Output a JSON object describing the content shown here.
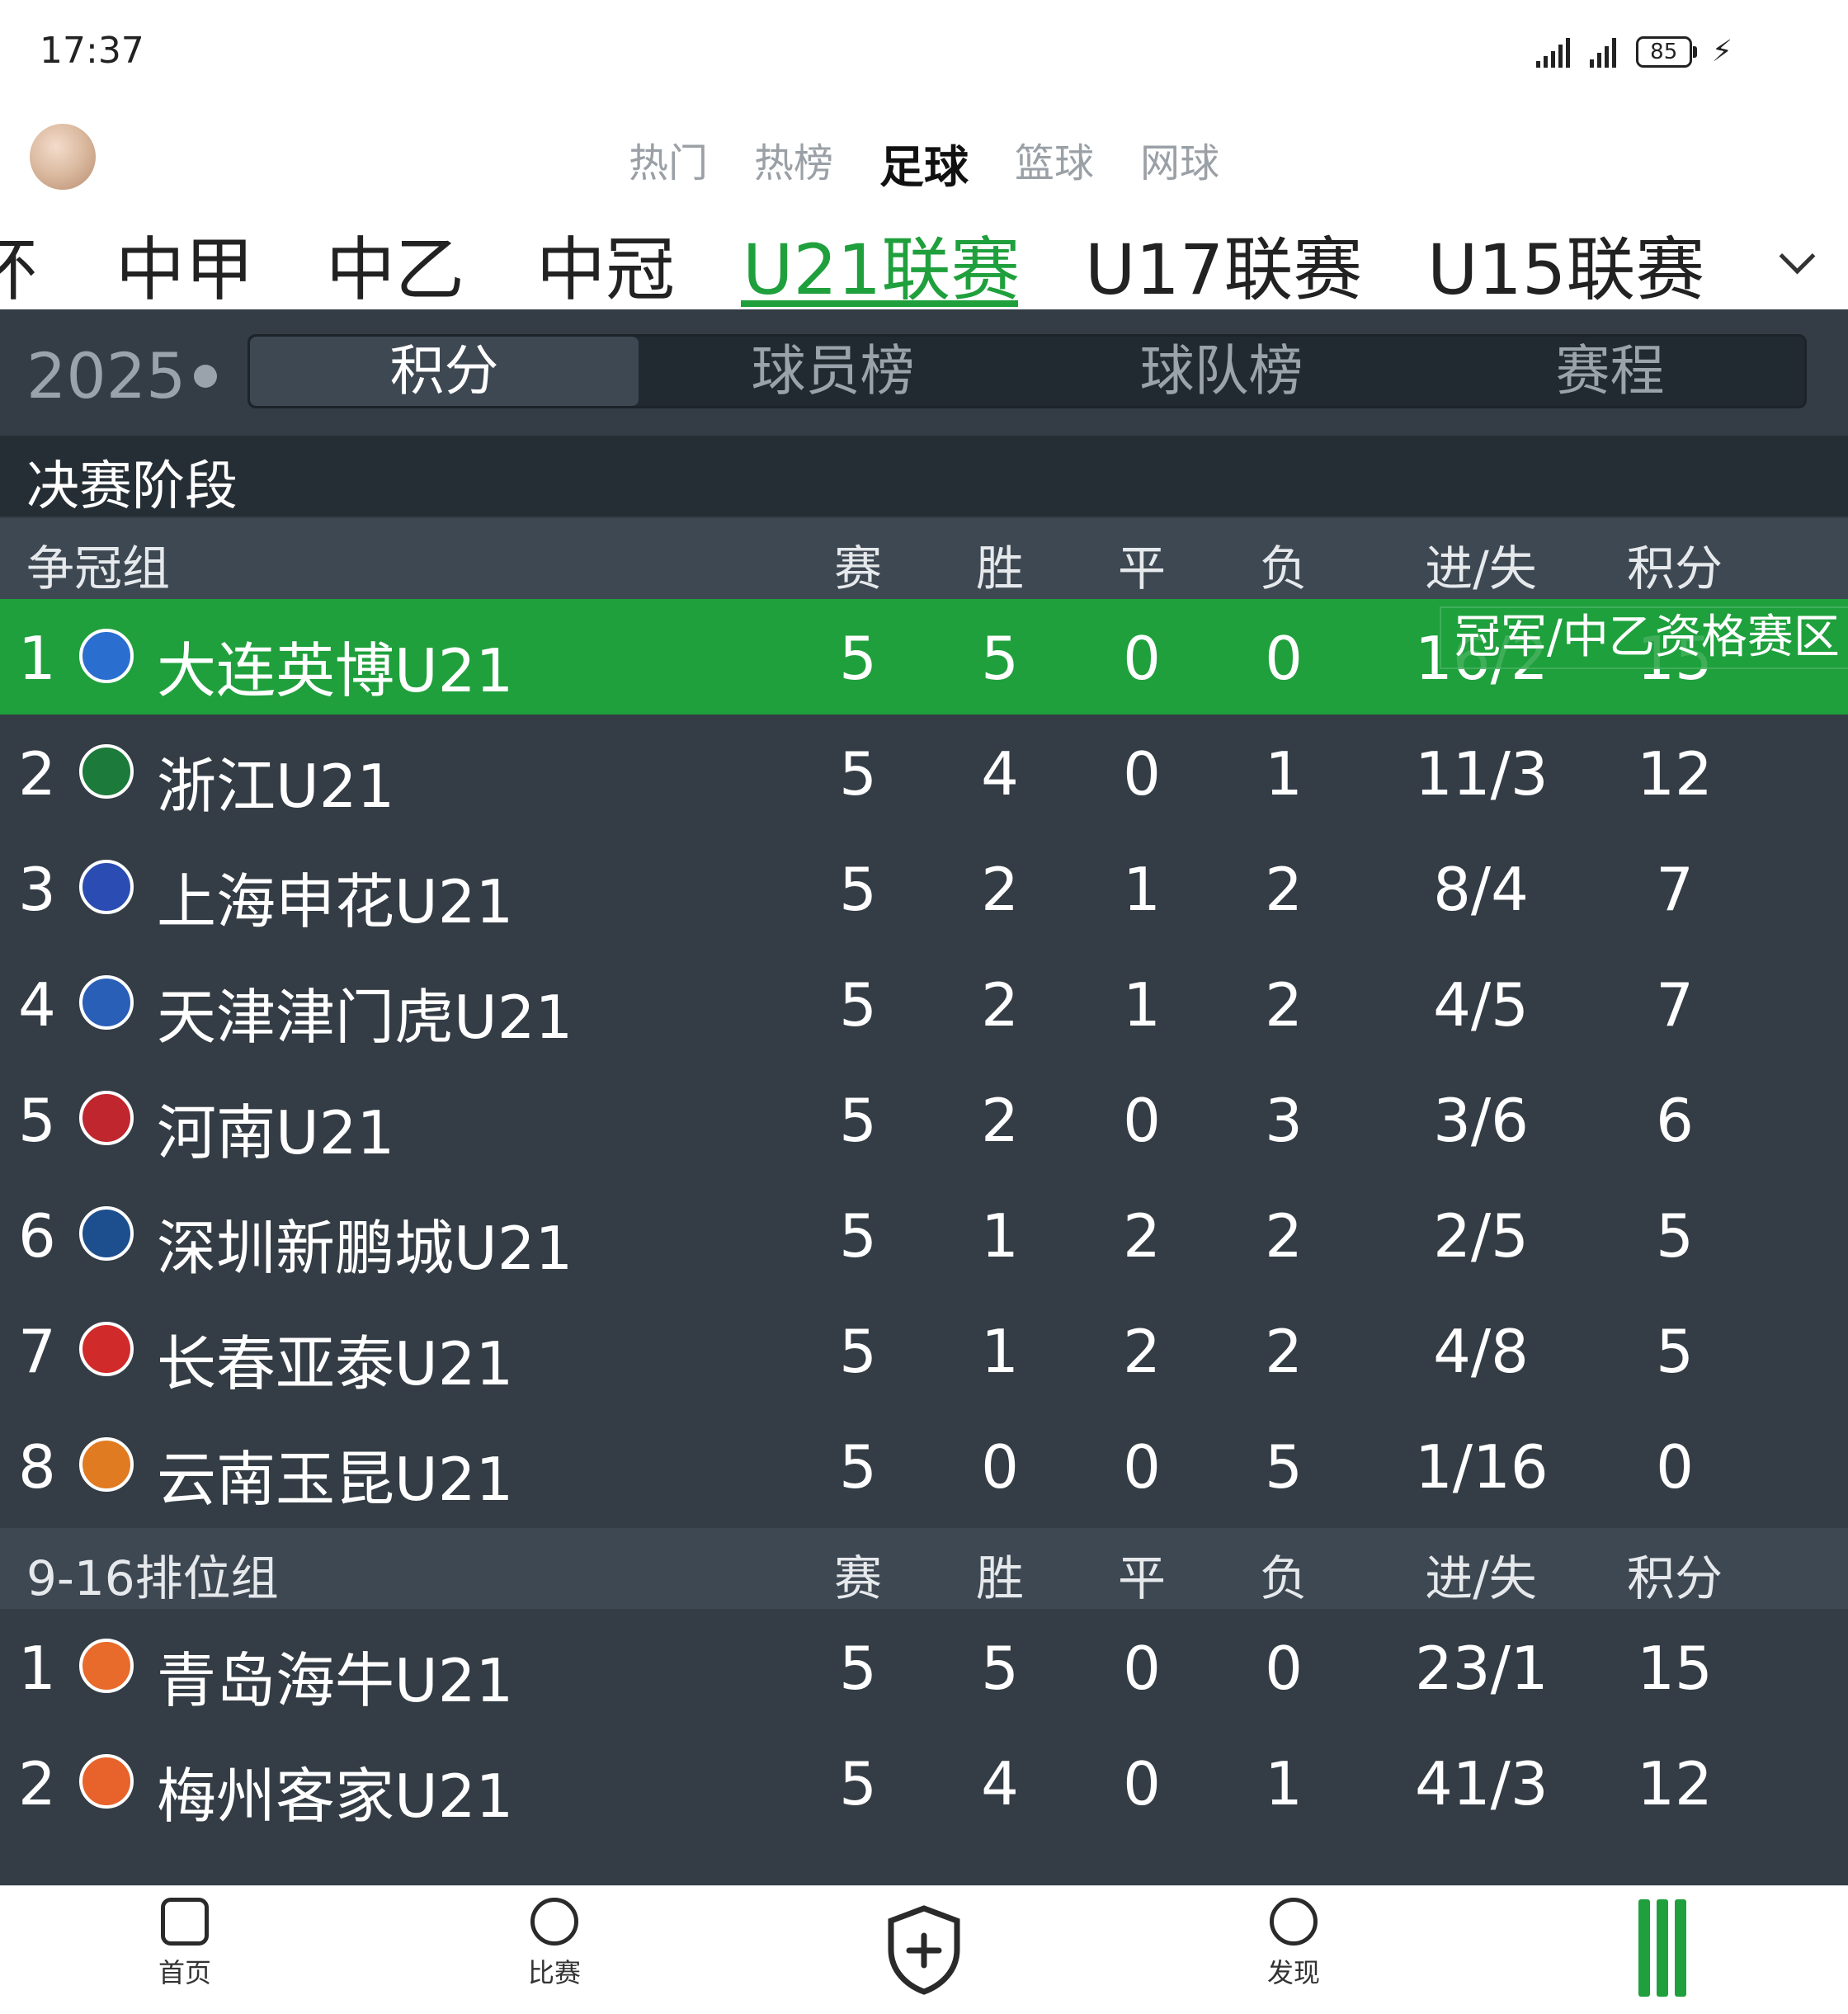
{
  "status_bar": {
    "time": "17:37",
    "battery": "85"
  },
  "top_tabs": [
    "热门",
    "热榜",
    "足球",
    "篮球",
    "网球"
  ],
  "top_tab_active": "足球",
  "league_tabs": [
    "杯",
    "中甲",
    "中乙",
    "中冠",
    "U21联赛",
    "U17联赛",
    "U15联赛"
  ],
  "league_tab_active": "U21联赛",
  "season": "2025",
  "segment_tabs": [
    "积分",
    "球员榜",
    "球队榜",
    "赛程"
  ],
  "segment_active": "积分",
  "stage_label": "决赛阶段",
  "columns": [
    "赛",
    "胜",
    "平",
    "负",
    "进/失",
    "积分"
  ],
  "zone_badge": "冠军/中乙资格赛区",
  "groups": [
    {
      "name": "争冠组",
      "rows": [
        {
          "rank": "1",
          "team": "大连英博U21",
          "p": "5",
          "w": "5",
          "d": "0",
          "l": "0",
          "gf_ga": "16/2",
          "pts": "15",
          "logo_color": "#2a6fd0",
          "highlight": true
        },
        {
          "rank": "2",
          "team": "浙江U21",
          "p": "5",
          "w": "4",
          "d": "0",
          "l": "1",
          "gf_ga": "11/3",
          "pts": "12",
          "logo_color": "#1c7a3a"
        },
        {
          "rank": "3",
          "team": "上海申花U21",
          "p": "5",
          "w": "2",
          "d": "1",
          "l": "2",
          "gf_ga": "8/4",
          "pts": "7",
          "logo_color": "#2b4db3"
        },
        {
          "rank": "4",
          "team": "天津津门虎U21",
          "p": "5",
          "w": "2",
          "d": "1",
          "l": "2",
          "gf_ga": "4/5",
          "pts": "7",
          "logo_color": "#2a5fb8"
        },
        {
          "rank": "5",
          "team": "河南U21",
          "p": "5",
          "w": "2",
          "d": "0",
          "l": "3",
          "gf_ga": "3/6",
          "pts": "6",
          "logo_color": "#c0262d"
        },
        {
          "rank": "6",
          "team": "深圳新鹏城U21",
          "p": "5",
          "w": "1",
          "d": "2",
          "l": "2",
          "gf_ga": "2/5",
          "pts": "5",
          "logo_color": "#1d4f8f"
        },
        {
          "rank": "7",
          "team": "长春亚泰U21",
          "p": "5",
          "w": "1",
          "d": "2",
          "l": "2",
          "gf_ga": "4/8",
          "pts": "5",
          "logo_color": "#d12a2a"
        },
        {
          "rank": "8",
          "team": "云南玉昆U21",
          "p": "5",
          "w": "0",
          "d": "0",
          "l": "5",
          "gf_ga": "1/16",
          "pts": "0",
          "logo_color": "#e07b22"
        }
      ]
    },
    {
      "name": "9-16排位组",
      "rows": [
        {
          "rank": "1",
          "team": "青岛海牛U21",
          "p": "5",
          "w": "5",
          "d": "0",
          "l": "0",
          "gf_ga": "23/1",
          "pts": "15",
          "logo_color": "#e86b2b"
        },
        {
          "rank": "2",
          "team": "梅州客家U21",
          "p": "5",
          "w": "4",
          "d": "0",
          "l": "1",
          "gf_ga": "41/3",
          "pts": "12",
          "logo_color": "#e8622b"
        }
      ]
    }
  ],
  "bottom_nav": [
    "首页",
    "比赛",
    "发现"
  ],
  "colors": {
    "accent": "#1fa03c",
    "bg_dark": "#343d45",
    "header_dark": "#262e35"
  }
}
